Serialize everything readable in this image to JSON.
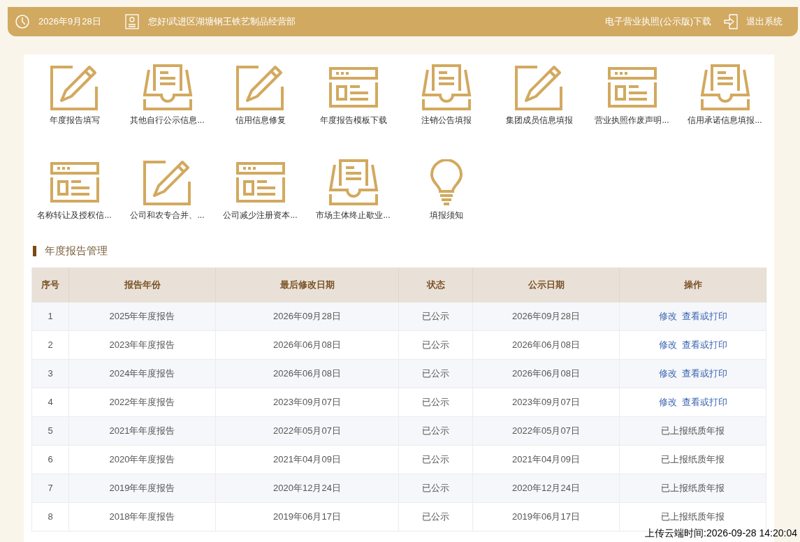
{
  "header": {
    "date": "2026年9月28日",
    "greeting": "您好!武进区湖塘钢王铁艺制品经营部",
    "license_link": "电子营业执照(公示版)下载",
    "logout": "退出系统"
  },
  "shortcuts": [
    {
      "kind": "edit",
      "label": "年度报告填写"
    },
    {
      "kind": "tray",
      "label": "其他自行公示信息..."
    },
    {
      "kind": "edit",
      "label": "信用信息修复"
    },
    {
      "kind": "window",
      "label": "年度报告模板下载"
    },
    {
      "kind": "tray",
      "label": "注销公告填报"
    },
    {
      "kind": "edit",
      "label": "集团成员信息填报"
    },
    {
      "kind": "window",
      "label": "营业执照作废声明..."
    },
    {
      "kind": "tray",
      "label": "信用承诺信息填报..."
    },
    {
      "kind": "window",
      "label": "名称转让及授权信..."
    },
    {
      "kind": "edit",
      "label": "公司和农专合并、..."
    },
    {
      "kind": "window",
      "label": "公司减少注册资本..."
    },
    {
      "kind": "tray",
      "label": "市场主体终止歇业..."
    },
    {
      "kind": "bulb",
      "label": "填报须知"
    }
  ],
  "section_title": "年度报告管理",
  "table": {
    "columns": [
      "序号",
      "报告年份",
      "最后修改日期",
      "状态",
      "公示日期",
      "操作"
    ],
    "rows": [
      {
        "cells": [
          "1",
          "2025年年度报告",
          "2026年09月28日",
          "已公示",
          "2026年09月28日"
        ],
        "action": {
          "kind": "links",
          "links": [
            "修改",
            "查看或打印"
          ]
        }
      },
      {
        "cells": [
          "2",
          "2023年年度报告",
          "2026年06月08日",
          "已公示",
          "2026年06月08日"
        ],
        "action": {
          "kind": "links",
          "links": [
            "修改",
            "查看或打印"
          ]
        }
      },
      {
        "cells": [
          "3",
          "2024年年度报告",
          "2026年06月08日",
          "已公示",
          "2026年06月08日"
        ],
        "action": {
          "kind": "links",
          "links": [
            "修改",
            "查看或打印"
          ]
        }
      },
      {
        "cells": [
          "4",
          "2022年年度报告",
          "2023年09月07日",
          "已公示",
          "2023年09月07日"
        ],
        "action": {
          "kind": "links",
          "links": [
            "修改",
            "查看或打印"
          ]
        }
      },
      {
        "cells": [
          "5",
          "2021年年度报告",
          "2022年05月07日",
          "已公示",
          "2022年05月07日"
        ],
        "action": {
          "kind": "text",
          "text": "已上报纸质年报"
        }
      },
      {
        "cells": [
          "6",
          "2020年年度报告",
          "2021年04月09日",
          "已公示",
          "2021年04月09日"
        ],
        "action": {
          "kind": "text",
          "text": "已上报纸质年报"
        }
      },
      {
        "cells": [
          "7",
          "2019年年度报告",
          "2020年12月24日",
          "已公示",
          "2020年12月24日"
        ],
        "action": {
          "kind": "text",
          "text": "已上报纸质年报"
        }
      },
      {
        "cells": [
          "8",
          "2018年年度报告",
          "2019年06月17日",
          "已公示",
          "2019年06月17日"
        ],
        "action": {
          "kind": "text",
          "text": "已上报纸质年报"
        }
      }
    ]
  },
  "upload_time": "上传云端时间:2026-09-28 14:20:04"
}
